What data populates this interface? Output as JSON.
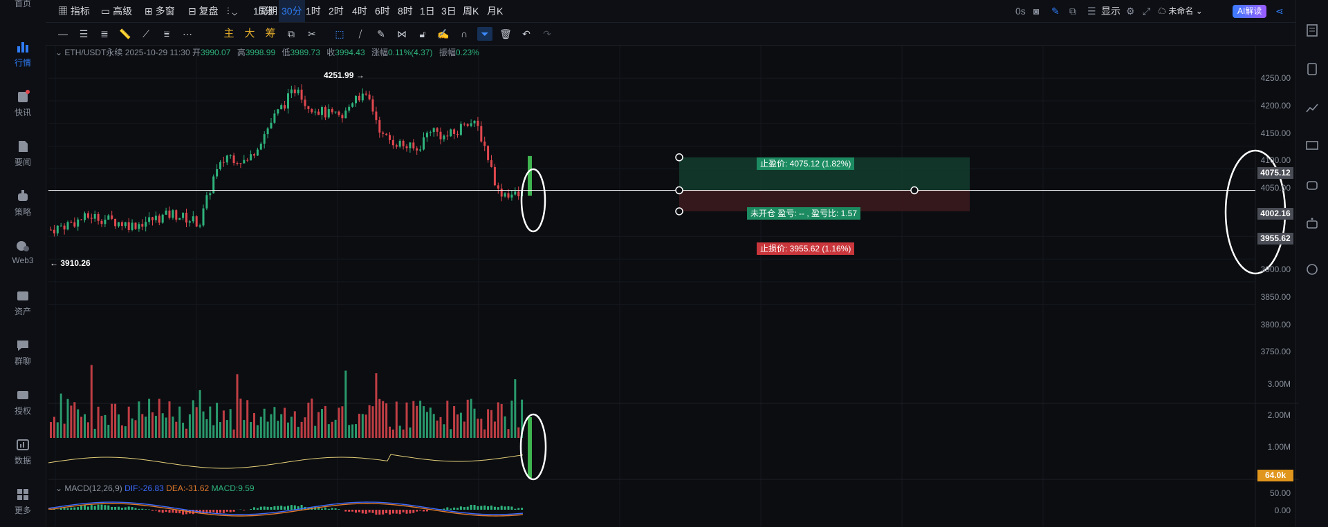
{
  "left_nav": [
    {
      "label": "首页",
      "icon": "home-icon"
    },
    {
      "label": "行情",
      "icon": "bar-chart-icon",
      "active": true
    },
    {
      "label": "快讯",
      "icon": "news-icon"
    },
    {
      "label": "要闻",
      "icon": "document-icon"
    },
    {
      "label": "策略",
      "icon": "robot-icon"
    },
    {
      "label": "Web3",
      "icon": "web3-icon"
    },
    {
      "label": "资产",
      "icon": "wallet-icon"
    },
    {
      "label": "群聊",
      "icon": "chat-icon"
    },
    {
      "label": "授权",
      "icon": "key-icon"
    },
    {
      "label": "数据",
      "icon": "data-icon"
    },
    {
      "label": "更多",
      "icon": "grid-icon"
    }
  ],
  "toolbar": {
    "indicator": "指标",
    "advanced": "高级",
    "multi_window": "多窗",
    "replay": "复盘",
    "period": "周期",
    "timeframes": [
      "15分",
      "30分",
      "1时",
      "2时",
      "4时",
      "6时",
      "8时",
      "1日",
      "3日",
      "周K",
      "月K"
    ],
    "selected_timeframe": "30分",
    "countdown": "0s",
    "display": "显示",
    "layout_name": "未命名",
    "ai_button": "AI解读"
  },
  "drawing_tools": {
    "main": "主",
    "big": "大",
    "chips": "筹"
  },
  "ohlc": {
    "symbol": "ETH/USDT永续",
    "datetime": "2025-10-29 11:30",
    "open_label": "开",
    "open": "3990.07",
    "high_label": "高",
    "high": "3998.99",
    "low_label": "低",
    "low": "3989.73",
    "close_label": "收",
    "close": "3994.43",
    "change_label": "涨幅",
    "change": "0.11%(4.37)",
    "amplitude_label": "振幅",
    "amplitude": "0.23%"
  },
  "macd": {
    "title": "MACD(12,26,9)",
    "dif": "DIF:-26.83",
    "dea": "DEA:-31.62",
    "macd": "MACD:9.59"
  },
  "price_axis": [
    "4250.00",
    "4200.00",
    "4150.00",
    "4100.00",
    "4050.00",
    "3900.00",
    "3850.00",
    "3800.00",
    "3750.00"
  ],
  "volume_axis": [
    "3.00M",
    "2.00M",
    "1.00M"
  ],
  "macd_axis": [
    "50.00",
    "0.00"
  ],
  "markers": {
    "high": "4251.99",
    "low": "3910.26"
  },
  "position": {
    "take_profit": "止盈价: 4075.12 (1.82%)",
    "open_label": "未开仓 盈亏: -- , 盈亏比: 1.57",
    "stop_loss": "止损价: 3955.62 (1.16%)",
    "tp_price": "4075.12",
    "entry_price": "4002.16",
    "sl_price": "3955.62"
  },
  "volume_tag": "64.0k",
  "colors": {
    "up": "#2fb37c",
    "down": "#e0484e",
    "accent": "#2f7cf6",
    "tp_zone": "#123a2c",
    "sl_zone": "#3a1a1d"
  }
}
